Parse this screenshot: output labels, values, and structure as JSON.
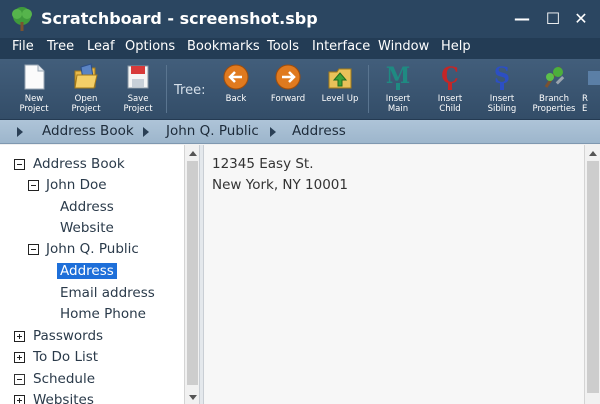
{
  "window": {
    "title": "Scratchboard - screenshot.sbp",
    "minimize_glyph": "—",
    "maximize_glyph": "☐",
    "close_glyph": "✕"
  },
  "menu": [
    "File",
    "Tree",
    "Leaf",
    "Options",
    "Bookmarks",
    "Tools",
    "Interface",
    "Window",
    "Help"
  ],
  "toolbar": {
    "tree_label": "Tree:",
    "buttons": [
      {
        "line1": "New",
        "line2": "Project",
        "icon": "new-document-icon"
      },
      {
        "line1": "Open",
        "line2": "Project",
        "icon": "open-folder-icon"
      },
      {
        "line1": "Save",
        "line2": "Project",
        "icon": "save-disk-icon"
      },
      {
        "line1": "Back",
        "line2": "",
        "icon": "back-arrow-icon"
      },
      {
        "line1": "Forward",
        "line2": "",
        "icon": "forward-arrow-icon"
      },
      {
        "line1": "Level Up",
        "line2": "",
        "icon": "level-up-icon"
      },
      {
        "line1": "Insert",
        "line2": "Main",
        "icon": "insert-main-icon"
      },
      {
        "line1": "Insert",
        "line2": "Child",
        "icon": "insert-child-icon"
      },
      {
        "line1": "Insert",
        "line2": "Sibling",
        "icon": "insert-sibling-icon"
      },
      {
        "line1": "Branch",
        "line2": "Properties",
        "icon": "branch-properties-icon"
      },
      {
        "line1": "R",
        "line2": "E",
        "icon": "partial-button-icon"
      }
    ]
  },
  "breadcrumb": [
    "Address Book",
    "John Q. Public",
    "Address"
  ],
  "tree": [
    {
      "label": "Address Book",
      "expander": "minus"
    },
    {
      "label": "John Doe",
      "expander": "minus"
    },
    {
      "label": "Address",
      "expander": ""
    },
    {
      "label": "Website",
      "expander": ""
    },
    {
      "label": "John Q. Public",
      "expander": "minus"
    },
    {
      "label": "Address",
      "expander": "",
      "selected": true
    },
    {
      "label": "Email address",
      "expander": ""
    },
    {
      "label": "Home Phone",
      "expander": ""
    },
    {
      "label": "Passwords",
      "expander": "plus"
    },
    {
      "label": "To Do List",
      "expander": "plus"
    },
    {
      "label": "Schedule",
      "expander": "empty"
    },
    {
      "label": "Websites",
      "expander": "plus"
    }
  ],
  "editor": {
    "lines": [
      "12345 Easy St.",
      "New York, NY 10001"
    ]
  },
  "colors": {
    "titlebar": "#2b4661",
    "menubar": "#233c55",
    "selection": "#1e6fd9",
    "breadcrumb_bg": "#aec4d8"
  }
}
